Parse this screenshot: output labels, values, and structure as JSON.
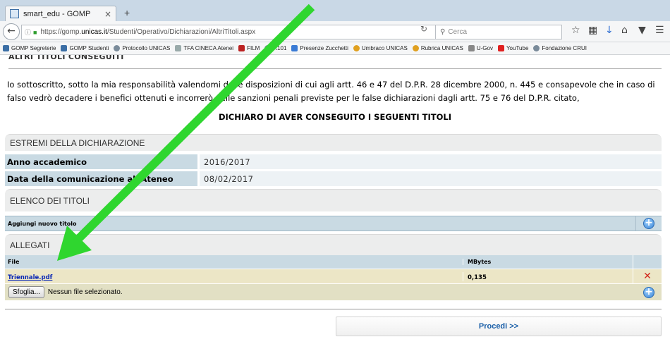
{
  "browser": {
    "tab_title": "smart_edu - GOMP",
    "tab_close": "×",
    "new_tab": "+",
    "url_prefix": "https://gomp.",
    "url_domain": "unicas.it",
    "url_path": "/Studenti/Operativo/Dichiarazioni/AltriTitoli.aspx",
    "search_placeholder": "Cerca",
    "bookmarks": [
      "GOMP Segreterie",
      "GOMP Studenti",
      "Protocollo UNICAS",
      "TFA CINECA Atenei",
      "FILM",
      "R101",
      "Presenze Zucchetti",
      "Umbraco UNICAS",
      "Rubrica UNICAS",
      "U-Gov",
      "YouTube",
      "Fondazione CRUI"
    ]
  },
  "page": {
    "title": "ALTRI TITOLI CONSEGUITI",
    "intro": "Io sottoscritto, sotto la mia responsabilità valendomi delle disposizioni di cui agli artt. 46 e 47 del D.P.R. 28 dicembre 2000, n. 445 e consapevole che in caso di falso vedrò decadere i benefici ottenuti e incorrerò nelle sanzioni penali previste per le false dichiarazioni dagli artt. 75 e 76 del D.P.R. citato,",
    "declare": "DICHIARO DI AVER CONSEGUITO I SEGUENTI TITOLI"
  },
  "estremi": {
    "header": "ESTREMI DELLA DICHIARAZIONE",
    "anno_label": "Anno accademico",
    "anno_value": "2016/2017",
    "data_label": "Data della comunicazione all'Ateneo",
    "data_value": "08/02/2017"
  },
  "titoli": {
    "header": "ELENCO DEI TITOLI",
    "add_label": "Aggiungi nuovo titolo"
  },
  "allegati": {
    "header": "ALLEGATI",
    "col_file": "File",
    "col_mbytes": "MBytes",
    "rows": [
      {
        "file": "Triennale.pdf",
        "mbytes": "0,135"
      }
    ],
    "browse_label": "Sfoglia...",
    "no_file_label": "Nessun file selezionato."
  },
  "actions": {
    "procedi_label": "Procedi >>"
  },
  "colors": {
    "annotation_arrow": "#2fd62f",
    "section_blue": "#c9dae3",
    "file_row": "#ece6c6"
  }
}
